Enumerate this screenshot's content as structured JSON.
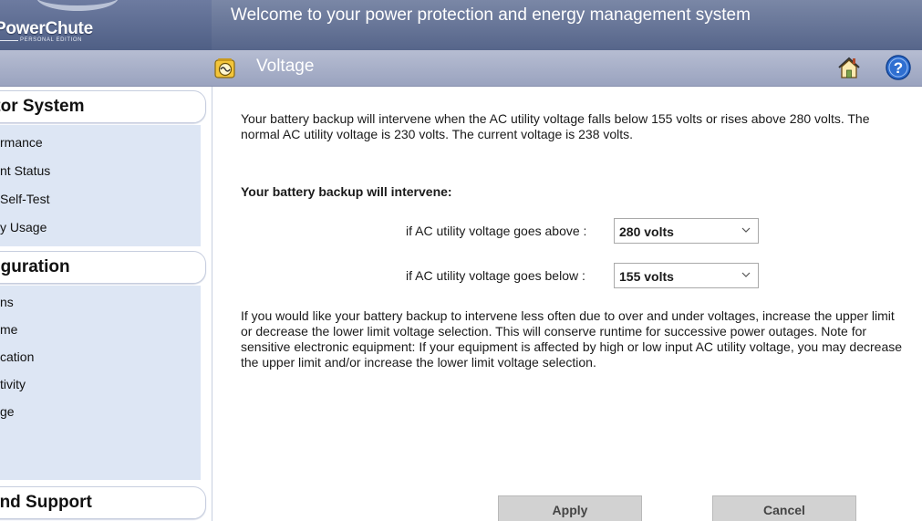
{
  "header": {
    "logo_name": "PowerChute",
    "logo_edition": "PERSONAL EDITION",
    "welcome": "Welcome to your power protection and energy management system"
  },
  "title_bar": {
    "title": "Voltage",
    "icons": {
      "page": "voltage-gauge-icon",
      "home": "home-icon",
      "help": "help-icon"
    }
  },
  "sidebar": {
    "sections": [
      {
        "label": "itor System",
        "items": [
          "rmance",
          "nt Status",
          "Self-Test",
          "y Usage"
        ]
      },
      {
        "label": "figuration",
        "items": [
          "ns",
          "me",
          "cation",
          "tivity",
          "ge"
        ]
      },
      {
        "label": "and Support",
        "items": []
      }
    ]
  },
  "main": {
    "intro": "Your battery backup will intervene when the AC utility voltage falls below 155 volts or rises above 280 volts. The normal AC utility voltage is 230 volts. The current voltage is 238 volts.",
    "intervene_heading": "Your battery backup will intervene:",
    "upper": {
      "label": "if AC utility voltage goes above :",
      "value": "280 volts"
    },
    "lower": {
      "label": "if AC utility voltage goes below :",
      "value": "155 volts"
    },
    "note": "If you would like your battery backup to intervene less often due to over and under voltages, increase the upper limit or decrease the lower limit voltage selection. This will conserve runtime for successive power outages. Note for sensitive electronic equipment: If your equipment is affected by high or low input AC utility voltage, you may decrease the upper limit and/or increase the lower limit voltage selection.",
    "apply_label": "Apply",
    "cancel_label": "Cancel"
  },
  "colors": {
    "header": "#56658a",
    "title_bar": "#9aa3bf",
    "menu_panel": "#dde6f4",
    "button": "#d2d2d2"
  }
}
